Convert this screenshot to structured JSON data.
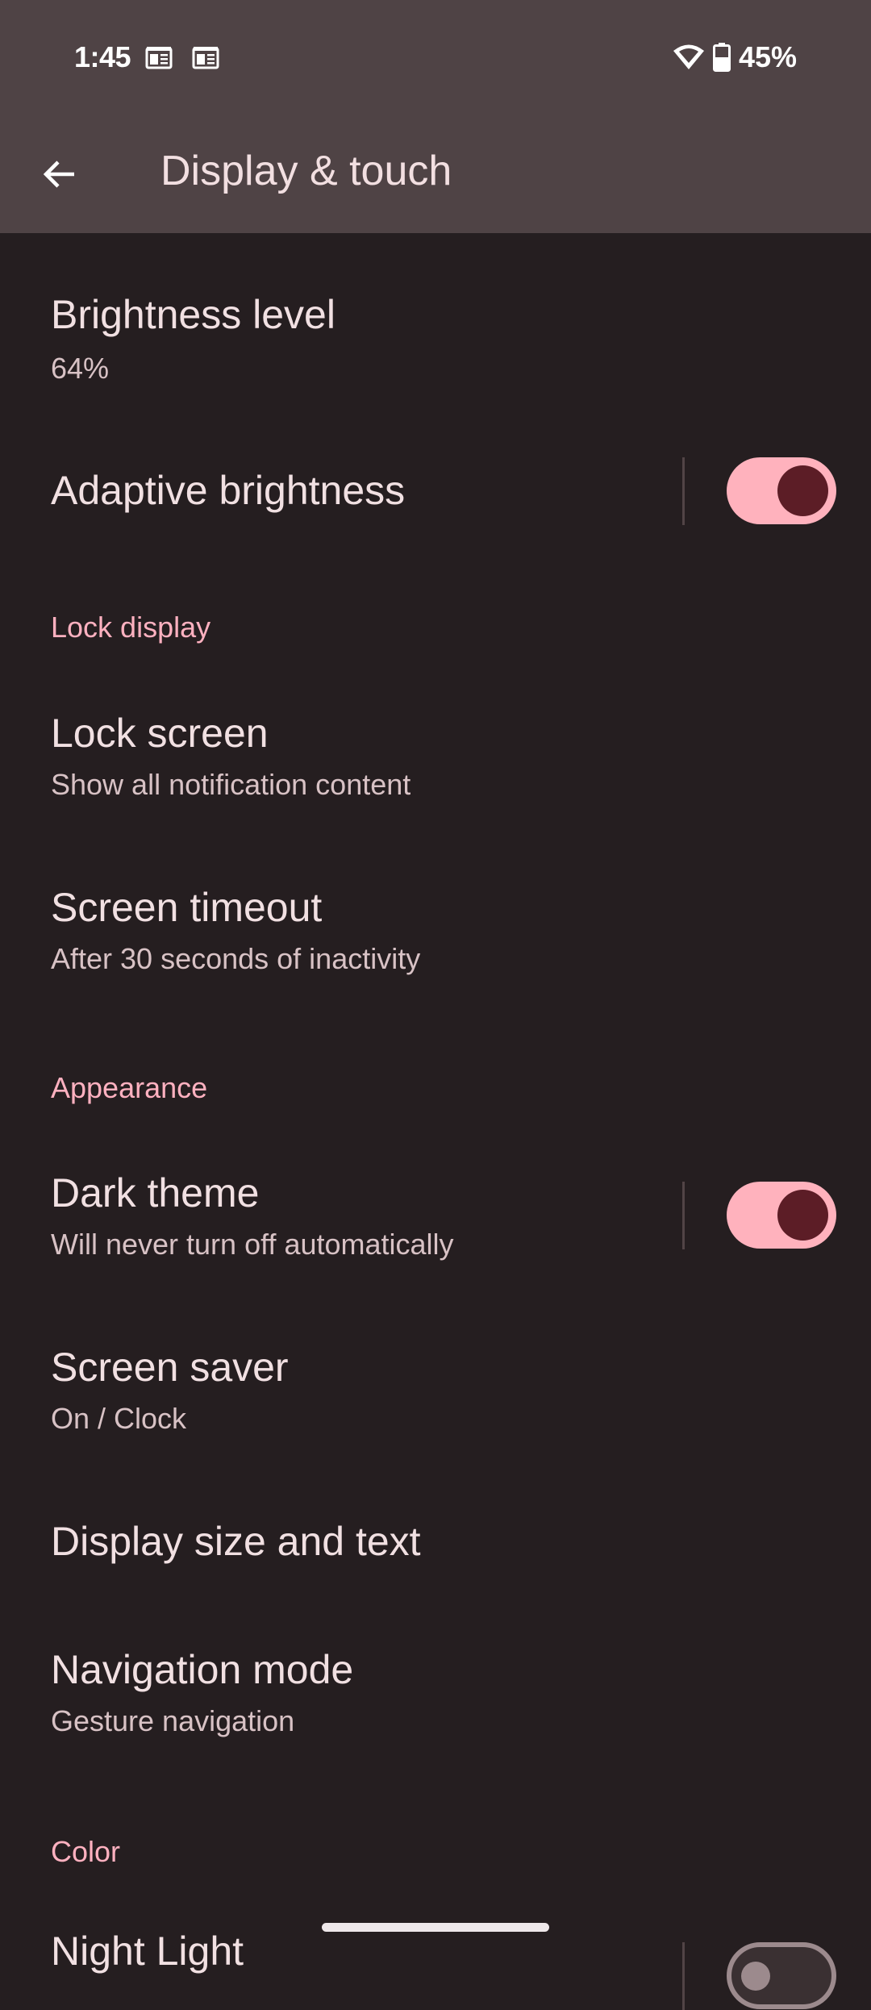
{
  "status_bar": {
    "time": "1:45",
    "left_icons": [
      "news-icon",
      "news-icon"
    ],
    "right_icons": [
      "wifi-icon",
      "battery-icon"
    ],
    "battery": "45%"
  },
  "app_bar": {
    "back_icon": "arrow-back-icon",
    "title": "Display & touch"
  },
  "items": {
    "brightness_level": {
      "title": "Brightness level",
      "subtitle": "64%"
    },
    "adaptive_brightness": {
      "title": "Adaptive brightness",
      "toggle_on": true
    },
    "lock_display_header": "Lock display",
    "lock_screen": {
      "title": "Lock screen",
      "subtitle": "Show all notification content"
    },
    "screen_timeout": {
      "title": "Screen timeout",
      "subtitle": "After 30 seconds of inactivity"
    },
    "appearance_header": "Appearance",
    "dark_theme": {
      "title": "Dark theme",
      "subtitle": "Will never turn off automatically",
      "toggle_on": true
    },
    "screen_saver": {
      "title": "Screen saver",
      "subtitle": "On / Clock"
    },
    "display_size": {
      "title": "Display size and text"
    },
    "navigation_mode": {
      "title": "Navigation mode",
      "subtitle": "Gesture navigation"
    },
    "color_header": "Color",
    "night_light": {
      "title": "Night Light",
      "toggle_on": false
    }
  },
  "colors": {
    "accent": "#ffb1c0",
    "toggle_track_on": "#ffb2bd",
    "toggle_knob_on": "#5c1d26",
    "background": "#251e20",
    "app_bar": "#4f4345"
  }
}
